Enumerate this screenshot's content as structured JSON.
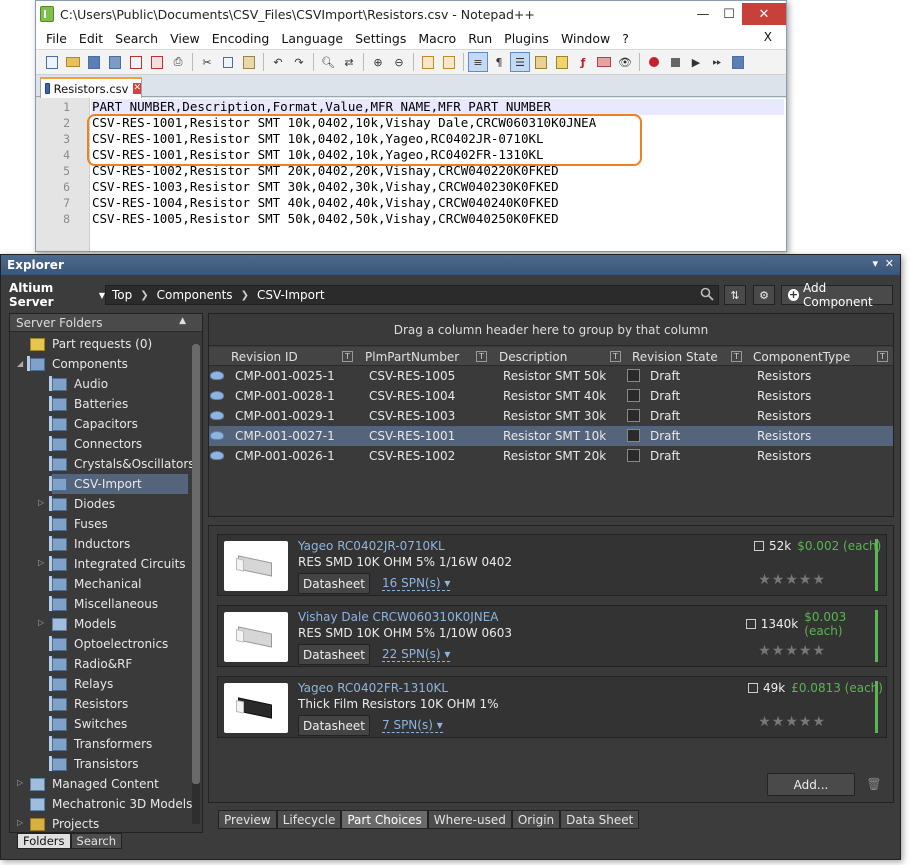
{
  "notepad": {
    "title": "C:\\Users\\Public\\Documents\\CSV_Files\\CSVImport\\Resistors.csv - Notepad++",
    "window_buttons": {
      "minimize": "—",
      "maximize": "☐",
      "close": "✕"
    },
    "menu": [
      "File",
      "Edit",
      "Search",
      "View",
      "Encoding",
      "Language",
      "Settings",
      "Macro",
      "Run",
      "Plugins",
      "Window",
      "?"
    ],
    "menu_close": "X",
    "tab_label": "Resistors.csv",
    "tab_close": "✕",
    "lines": [
      {
        "n": "1",
        "text": "PART NUMBER,Description,Format,Value,MFR NAME,MFR PART NUMBER"
      },
      {
        "n": "2",
        "text": "CSV-RES-1001,Resistor SMT 10k,0402,10k,Vishay Dale,CRCW060310K0JNEA"
      },
      {
        "n": "3",
        "text": "CSV-RES-1001,Resistor SMT 10k,0402,10k,Yageo,RC0402JR-0710KL"
      },
      {
        "n": "4",
        "text": "CSV-RES-1001,Resistor SMT 10k,0402,10k,Yageo,RC0402FR-1310KL"
      },
      {
        "n": "5",
        "text": "CSV-RES-1002,Resistor SMT 20k,0402,20k,Vishay,CRCW040220K0FKED"
      },
      {
        "n": "6",
        "text": "CSV-RES-1003,Resistor SMT 30k,0402,30k,Vishay,CRCW040230K0FKED"
      },
      {
        "n": "7",
        "text": "CSV-RES-1004,Resistor SMT 40k,0402,40k,Vishay,CRCW040240K0FKED"
      },
      {
        "n": "8",
        "text": "CSV-RES-1005,Resistor SMT 50k,0402,50k,Vishay,CRCW040250K0FKED"
      }
    ],
    "highlight_color": "#f07f21"
  },
  "explorer": {
    "title": "Explorer",
    "title_buttons": {
      "pin": "▾",
      "close": "✕"
    },
    "server": "Altium Server",
    "breadcrumb": [
      "Top",
      "Components",
      "CSV-Import"
    ],
    "add_component": "Add Component",
    "folders_header": "Server Folders",
    "tree": [
      {
        "label": "Part requests (0)",
        "icon": "request-icon"
      },
      {
        "label": "Components",
        "icon": "database-icon"
      },
      {
        "label": "Audio"
      },
      {
        "label": "Batteries"
      },
      {
        "label": "Capacitors"
      },
      {
        "label": "Connectors"
      },
      {
        "label": "Crystals&Oscillators"
      },
      {
        "label": "CSV-Import"
      },
      {
        "label": "Diodes"
      },
      {
        "label": "Fuses"
      },
      {
        "label": "Inductors"
      },
      {
        "label": "Integrated Circuits"
      },
      {
        "label": "Mechanical"
      },
      {
        "label": "Miscellaneous"
      },
      {
        "label": "Models"
      },
      {
        "label": "Optoelectronics"
      },
      {
        "label": "Radio&RF"
      },
      {
        "label": "Relays"
      },
      {
        "label": "Resistors"
      },
      {
        "label": "Switches"
      },
      {
        "label": "Transformers"
      },
      {
        "label": "Transistors"
      },
      {
        "label": "Managed Content"
      },
      {
        "label": "Mechatronic 3D Models"
      },
      {
        "label": "Projects"
      }
    ],
    "selected_folder": "CSV-Import",
    "folder_tabs": [
      "Folders",
      "Search"
    ],
    "group_hint": "Drag a column header here to group by that column",
    "columns": [
      "Revision ID",
      "PlmPartNumber",
      "Description",
      "Revision State",
      "ComponentType"
    ],
    "rows": [
      {
        "rev": "CMP-001-0025-1",
        "plm": "CSV-RES-1005",
        "desc": "Resistor SMT 50k",
        "state": "Draft",
        "type": "Resistors"
      },
      {
        "rev": "CMP-001-0028-1",
        "plm": "CSV-RES-1004",
        "desc": "Resistor SMT 40k",
        "state": "Draft",
        "type": "Resistors"
      },
      {
        "rev": "CMP-001-0029-1",
        "plm": "CSV-RES-1003",
        "desc": "Resistor SMT 30k",
        "state": "Draft",
        "type": "Resistors"
      },
      {
        "rev": "CMP-001-0027-1",
        "plm": "CSV-RES-1001",
        "desc": "Resistor SMT 10k",
        "state": "Draft",
        "type": "Resistors"
      },
      {
        "rev": "CMP-001-0026-1",
        "plm": "CSV-RES-1002",
        "desc": "Resistor SMT 20k",
        "state": "Draft",
        "type": "Resistors"
      }
    ],
    "selected_row": "CMP-001-0027-1",
    "part_choices": [
      {
        "mfr": "Yageo RC0402JR-0710KL",
        "desc": "RES SMD 10K OHM 5% 1/16W 0402",
        "datasheet": "Datasheet",
        "spn": "16 SPN(s)",
        "stock": "52k",
        "price": "$0.002 (each)",
        "stars": "★★★★★"
      },
      {
        "mfr": "Vishay Dale CRCW060310K0JNEA",
        "desc": "RES SMD 10K OHM 5% 1/10W 0603",
        "datasheet": "Datasheet",
        "spn": "22 SPN(s)",
        "stock": "1340k",
        "price": "$0.003 (each)",
        "stars": "★★★★★"
      },
      {
        "mfr": "Yageo RC0402FR-1310KL",
        "desc": "Thick Film Resistors 10K OHM 1%",
        "datasheet": "Datasheet",
        "spn": "7 SPN(s)",
        "stock": "49k",
        "price": "£0.0813 (each)",
        "stars": "★★★★★"
      }
    ],
    "add_button": "Add...",
    "bottom_tabs": [
      "Preview",
      "Lifecycle",
      "Part Choices",
      "Where-used",
      "Origin",
      "Data Sheet"
    ],
    "active_bottom_tab": "Part Choices",
    "price_color": "#5ab552"
  }
}
